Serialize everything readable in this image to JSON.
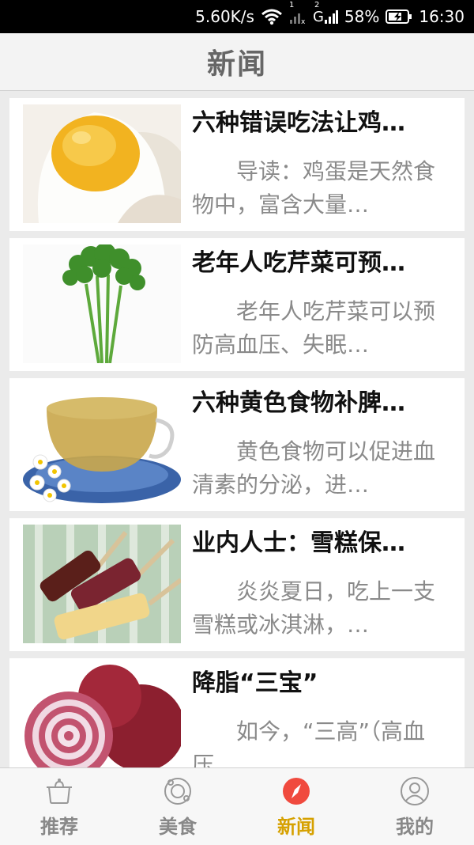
{
  "status_bar": {
    "speed": "5.60K/s",
    "sim1": "1",
    "sim2": "2",
    "network": "G",
    "battery": "58%",
    "time": "16:30"
  },
  "header": {
    "title": "新闻"
  },
  "news": [
    {
      "title": "六种错误吃法让鸡…",
      "summary": "导读：鸡蛋是天然食物中，富含大量…",
      "image": "boiled-egg"
    },
    {
      "title": "老年人吃芹菜可预…",
      "summary": "老年人吃芹菜可以预防高血压、失眠…",
      "image": "celery"
    },
    {
      "title": "六种黄色食物补脾…",
      "summary": "黄色食物可以促进血清素的分泌，进…",
      "image": "chrysanthemum-tea"
    },
    {
      "title": "业内人士：雪糕保…",
      "summary": "炎炎夏日，吃上一支雪糕或冰淇淋，…",
      "image": "ice-pops"
    },
    {
      "title": "降脂“三宝”",
      "summary": "如今，“三高”（高血压、…",
      "image": "red-onion"
    }
  ],
  "bottom_nav": {
    "active": "新闻",
    "tabs": [
      {
        "label": "推荐",
        "icon": "pot-icon"
      },
      {
        "label": "美食",
        "icon": "food-plate-icon"
      },
      {
        "label": "新闻",
        "icon": "compass-icon"
      },
      {
        "label": "我的",
        "icon": "user-icon"
      }
    ]
  },
  "colors": {
    "active_tab": "#d6a100",
    "active_icon": "#f04a3e",
    "title": "#666666"
  }
}
